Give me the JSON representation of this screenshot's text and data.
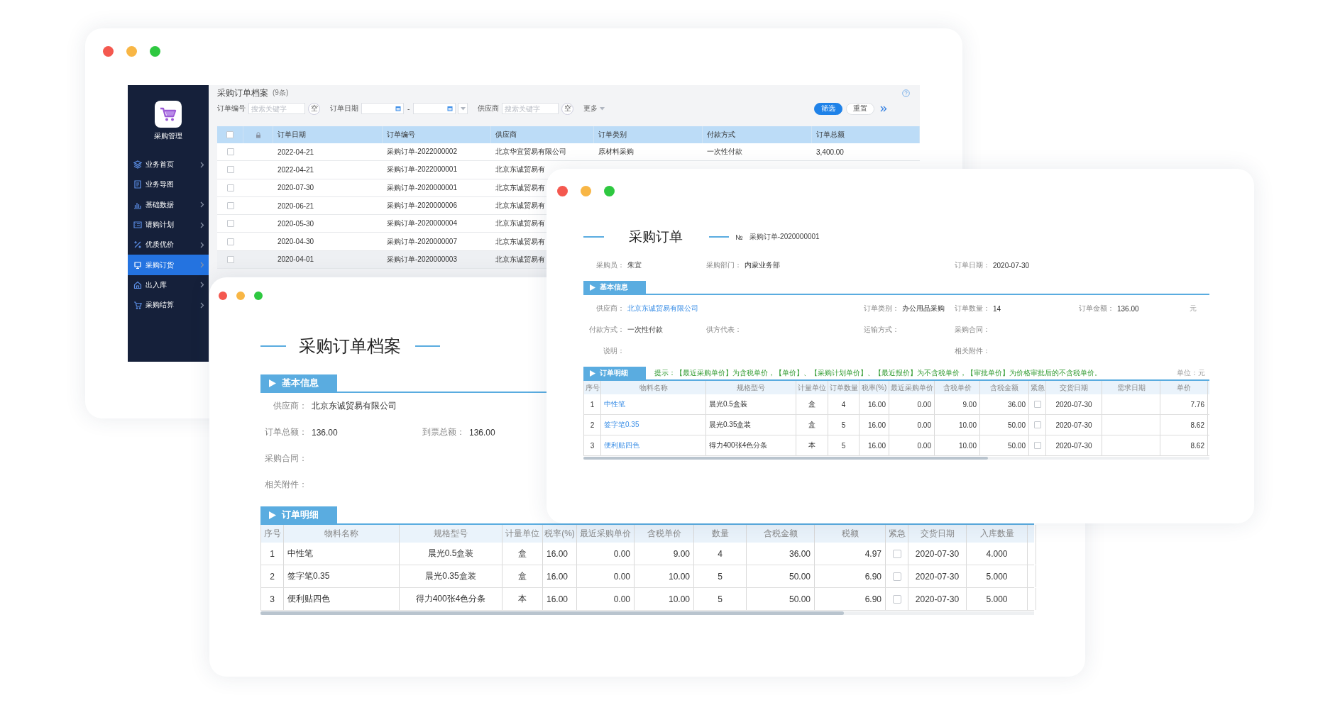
{
  "back_window": {
    "sidebar": {
      "app_name": "采购管理",
      "items": [
        {
          "label": "业务首页",
          "selected": false,
          "chevron": true
        },
        {
          "label": "业务导图",
          "selected": false,
          "chevron": false
        },
        {
          "label": "基础数据",
          "selected": false,
          "chevron": true
        },
        {
          "label": "请购计划",
          "selected": false,
          "chevron": true
        },
        {
          "label": "优质优价",
          "selected": false,
          "chevron": true
        },
        {
          "label": "采购订货",
          "selected": true,
          "chevron": true
        },
        {
          "label": "出入库",
          "selected": false,
          "chevron": true
        },
        {
          "label": "采购结算",
          "selected": false,
          "chevron": true
        }
      ]
    },
    "title": "采购订单档案",
    "count": "(9条)",
    "filters": {
      "order_no": {
        "label": "订单编号",
        "placeholder": "搜索关键字",
        "clear": "空"
      },
      "order_date": {
        "label": "订单日期",
        "separator": "-"
      },
      "supplier": {
        "label": "供应商",
        "placeholder": "搜索关键字",
        "clear": "空"
      },
      "more": "更多"
    },
    "buttons": [
      {
        "label": "筛选",
        "primary": true
      },
      {
        "label": "重置",
        "primary": false
      }
    ],
    "table": {
      "header_checked": false,
      "columns": [
        "订单日期",
        "订单编号",
        "供应商",
        "订单类别",
        "付款方式",
        "订单总额"
      ],
      "rows": [
        {
          "checked": false,
          "selected": false,
          "cells": [
            "2022-04-21",
            "采购订单-2022000002",
            "北京华宜贸易有限公司",
            "原材料采购",
            "一次性付款",
            "3,400.00"
          ]
        },
        {
          "checked": false,
          "selected": false,
          "cells": [
            "2022-04-21",
            "采购订单-2022000001",
            "北京东诚贸易有"
          ]
        },
        {
          "checked": false,
          "selected": false,
          "cells": [
            "2020-07-30",
            "采购订单-2020000001",
            "北京东诚贸易有"
          ]
        },
        {
          "checked": false,
          "selected": false,
          "cells": [
            "2020-06-21",
            "采购订单-2020000006",
            "北京东诚贸易有"
          ]
        },
        {
          "checked": false,
          "selected": false,
          "cells": [
            "2020-05-30",
            "采购订单-2020000004",
            "北京东诚贸易有"
          ]
        },
        {
          "checked": false,
          "selected": false,
          "cells": [
            "2020-04-30",
            "采购订单-2020000007",
            "北京东诚贸易有"
          ]
        },
        {
          "checked": false,
          "selected": true,
          "cells": [
            "2020-04-01",
            "采购订单-2020000003",
            "北京东诚贸易有"
          ]
        }
      ]
    }
  },
  "archive_window": {
    "title": "采购订单档案",
    "basic_info": {
      "title": "基本信息",
      "fields": [
        {
          "label": "供应商：",
          "value": "北京东诚贸易有限公司"
        },
        {
          "label": "订单总额：",
          "value": "136.00"
        },
        {
          "label": "到票总额：",
          "value": "136.00"
        },
        {
          "label": "采购合同："
        },
        {
          "label": "相关附件："
        }
      ]
    },
    "detail": {
      "title": "订单明细",
      "columns": [
        {
          "label": "序号",
          "kind": "text"
        },
        {
          "label": "物料名称",
          "kind": "text"
        },
        {
          "label": "规格型号",
          "kind": "text"
        },
        {
          "label": "计量单位",
          "kind": "text"
        },
        {
          "label": "税率(%)",
          "kind": "text"
        },
        {
          "label": "最近采购单价",
          "kind": "text"
        },
        {
          "label": "含税单价",
          "kind": "text"
        },
        {
          "label": "数量",
          "kind": "text"
        },
        {
          "label": "含税金额",
          "kind": "text"
        },
        {
          "label": "税额",
          "kind": "text"
        },
        {
          "label": "紧急",
          "kind": "check"
        },
        {
          "label": "交货日期",
          "kind": "text"
        },
        {
          "label": "入库数量",
          "kind": "text"
        }
      ],
      "rows": [
        {
          "cells": [
            "1",
            "中性笔",
            "晨光0.5盒装",
            "盒",
            "16.00",
            "0.00",
            "9.00",
            "4",
            "36.00",
            "4.97",
            {
              "checked": false
            },
            "2020-07-30",
            "4.000"
          ]
        },
        {
          "cells": [
            "2",
            "签字笔0.35",
            "晨光0.35盒装",
            "盒",
            "16.00",
            "0.00",
            "10.00",
            "5",
            "50.00",
            "6.90",
            {
              "checked": false
            },
            "2020-07-30",
            "5.000"
          ]
        },
        {
          "cells": [
            "3",
            "便利贴四色",
            "得力400张4色分条",
            "本",
            "16.00",
            "0.00",
            "10.00",
            "5",
            "50.00",
            "6.90",
            {
              "checked": false
            },
            "2020-07-30",
            "5.000"
          ]
        }
      ]
    }
  },
  "order_window": {
    "title": "采购订单",
    "number_sign": "№",
    "number": "采购订单-2020000001",
    "header_fields": [
      {
        "label": "采购员：",
        "value": "朱宜"
      },
      {
        "label": "采购部门：",
        "value": "内蒙业务部"
      },
      {
        "label": "订单日期：",
        "value": "2020-07-30"
      }
    ],
    "basic_info": {
      "title": "基本信息",
      "fields": [
        {
          "label": "供应商：",
          "value": "北京东诚贸易有限公司",
          "link": true
        },
        {
          "label": "订单类别：",
          "value": "办公用品采购",
          "link": false
        },
        {
          "label": "订单数量：",
          "value": "14",
          "link": false
        },
        {
          "label": "订单金额：",
          "value": "136.00",
          "unit": "元",
          "link": false
        },
        {
          "label": "付款方式：",
          "value": "一次性付款",
          "link": false
        },
        {
          "label": "供方代表："
        },
        {
          "label": "运输方式："
        },
        {
          "label": "采购合同："
        },
        {
          "label": "说明："
        },
        {
          "label": "相关附件："
        }
      ]
    },
    "detail": {
      "title": "订单明细",
      "hint": "提示：【最近采购单价】为含税单价，【单价】、【采购计划单价】、【最近报价】为不含税单价，【审批单价】为价格审批后的不含税单价。",
      "unit": "单位：元",
      "columns": [
        {
          "label": "序号",
          "kind": "text"
        },
        {
          "label": "物料名称",
          "kind": "link"
        },
        {
          "label": "规格型号",
          "kind": "text"
        },
        {
          "label": "计量单位",
          "kind": "text"
        },
        {
          "label": "订单数量",
          "kind": "text"
        },
        {
          "label": "税率(%)",
          "kind": "text"
        },
        {
          "label": "最近采购单价",
          "kind": "text"
        },
        {
          "label": "含税单价",
          "kind": "text"
        },
        {
          "label": "含税金额",
          "kind": "text"
        },
        {
          "label": "紧急",
          "kind": "check"
        },
        {
          "label": "交货日期",
          "kind": "text"
        },
        {
          "label": "需求日期",
          "kind": "text"
        },
        {
          "label": "单价",
          "kind": "text"
        }
      ],
      "rows": [
        {
          "cells": [
            "1",
            "中性笔",
            "晨光0.5盒装",
            "盒",
            "4",
            "16.00",
            "0.00",
            "9.00",
            "36.00",
            {
              "checked": false
            },
            "2020-07-30",
            null,
            "7.76"
          ]
        },
        {
          "cells": [
            "2",
            "签字笔0.35",
            "晨光0.35盒装",
            "盒",
            "5",
            "16.00",
            "0.00",
            "10.00",
            "50.00",
            {
              "checked": false
            },
            "2020-07-30",
            null,
            "8.62"
          ]
        },
        {
          "cells": [
            "3",
            "便利贴四色",
            "得力400张4色分条",
            "本",
            "5",
            "16.00",
            "0.00",
            "10.00",
            "50.00",
            {
              "checked": false
            },
            "2020-07-30",
            null,
            "8.62"
          ]
        }
      ]
    }
  }
}
